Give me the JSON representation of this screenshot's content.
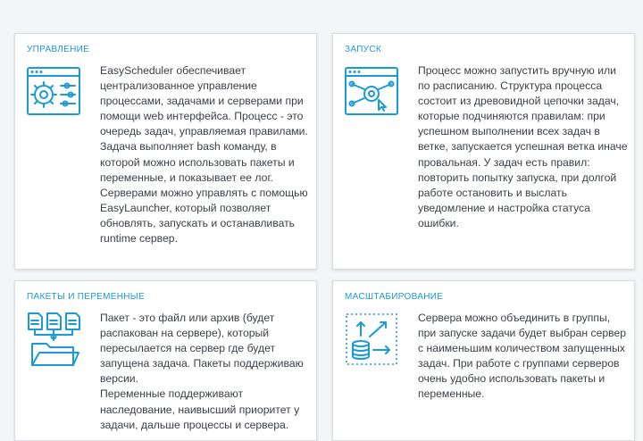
{
  "cards": [
    {
      "title": "УПРАВЛЕНИЕ",
      "icon": "gear-settings-window-icon",
      "paragraphs": [
        "EasyScheduler обеспечивает централизованное управление процессами, задачами и серверами при помощи web интерфейса. Процесс - это очередь задач, управляемая правилами. Задача выполняет bash команду, в которой можно использовать пакеты и переменные, и показывает ее лог. Серверами можно управлять с помощью EasyLauncher, который позволяет обновлять, запускать и останавливать runtime сервер."
      ]
    },
    {
      "title": "ЗАПУСК",
      "icon": "launch-workflow-window-icon",
      "paragraphs": [
        "Процесс можно запустить вручную или по расписанию. Структура процесса состоит из древовидной цепочки задач, которые подчиняются правилам: при успешном выполнении всех задач в ветке, запускается успешная ветка иначе провальная. У задач есть правил: повторить попытку запуска, при долгой работе остановить и выслать уведомление и настройка статуса ошибки."
      ]
    },
    {
      "title": "ПАКЕТЫ И ПЕРЕМЕННЫЕ",
      "icon": "files-to-folder-icon",
      "paragraphs": [
        "Пакет - это файл или архив (будет распакован на сервере), который пересылается на сервер где будет запущена задача. Пакеты поддерживаю версии.",
        "Переменные поддерживают наследование, наивысший приоритет у задачи, дальше процессы и сервера."
      ]
    },
    {
      "title": "МАСШТАБИРОВАНИЕ",
      "icon": "database-scaling-icon",
      "paragraphs": [
        "Сервера можно объединить в группы, при запуске задачи будет выбран сервер с наименьшим количеством запущенных задач. При работе с группами серверов очень удобно использовать пакеты и переменные."
      ]
    }
  ],
  "colors": {
    "accent": "#1a9bd7",
    "text": "#3a3f45",
    "background": "#f3f5f7"
  }
}
